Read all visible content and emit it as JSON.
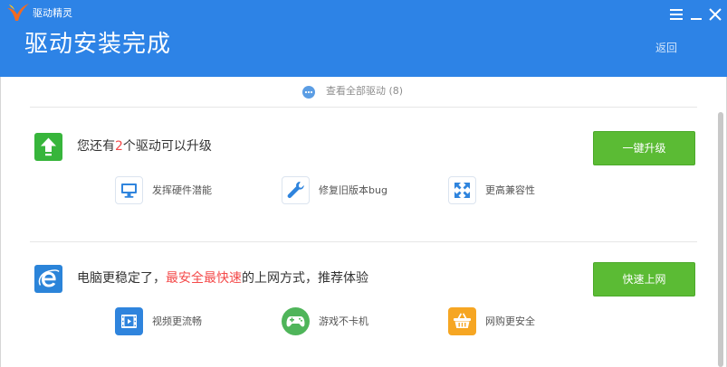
{
  "window": {
    "app_name": "驱动精灵",
    "title": "驱动安装完成",
    "back_label": "返回",
    "icons": {
      "logo": "app-logo-icon",
      "menu": "menu-icon",
      "minimize": "minimize-icon",
      "close": "close-icon"
    }
  },
  "view_all": {
    "icon": "more-icon",
    "label": "查看全部驱动 (8)"
  },
  "sections": {
    "upgrade": {
      "icon": "upgrade-arrow-icon",
      "message_prefix": "您还有",
      "message_highlight": "2",
      "message_suffix": "个驱动可以升级",
      "button_label": "一键升级",
      "features": [
        {
          "icon": "monitor-icon",
          "label": "发挥硬件潜能"
        },
        {
          "icon": "wrench-icon",
          "label": "修复旧版本bug"
        },
        {
          "icon": "expand-arrows-icon",
          "label": "更高兼容性"
        }
      ]
    },
    "browser": {
      "icon": "ie-browser-icon",
      "message_prefix": "电脑更稳定了，",
      "message_highlight": "最安全最快速",
      "message_suffix": "的上网方式，推荐体验",
      "button_label": "快速上网",
      "features": [
        {
          "icon": "video-icon",
          "label": "视频更流畅"
        },
        {
          "icon": "gamepad-icon",
          "label": "游戏不卡机"
        },
        {
          "icon": "shopping-basket-icon",
          "label": "网购更安全"
        }
      ]
    }
  },
  "colors": {
    "header": "#2d83e6",
    "link_icon": "#5b9de4",
    "button": "#5bbb34",
    "button_border": "#4ca92a",
    "highlight": "#f44a4a",
    "upgrade_icon": "#37b53b",
    "ie_icon": "#2b84d9",
    "feature_blue": "#2f84dd",
    "feature_green": "#4fb55a",
    "feature_orange": "#f6a623"
  }
}
